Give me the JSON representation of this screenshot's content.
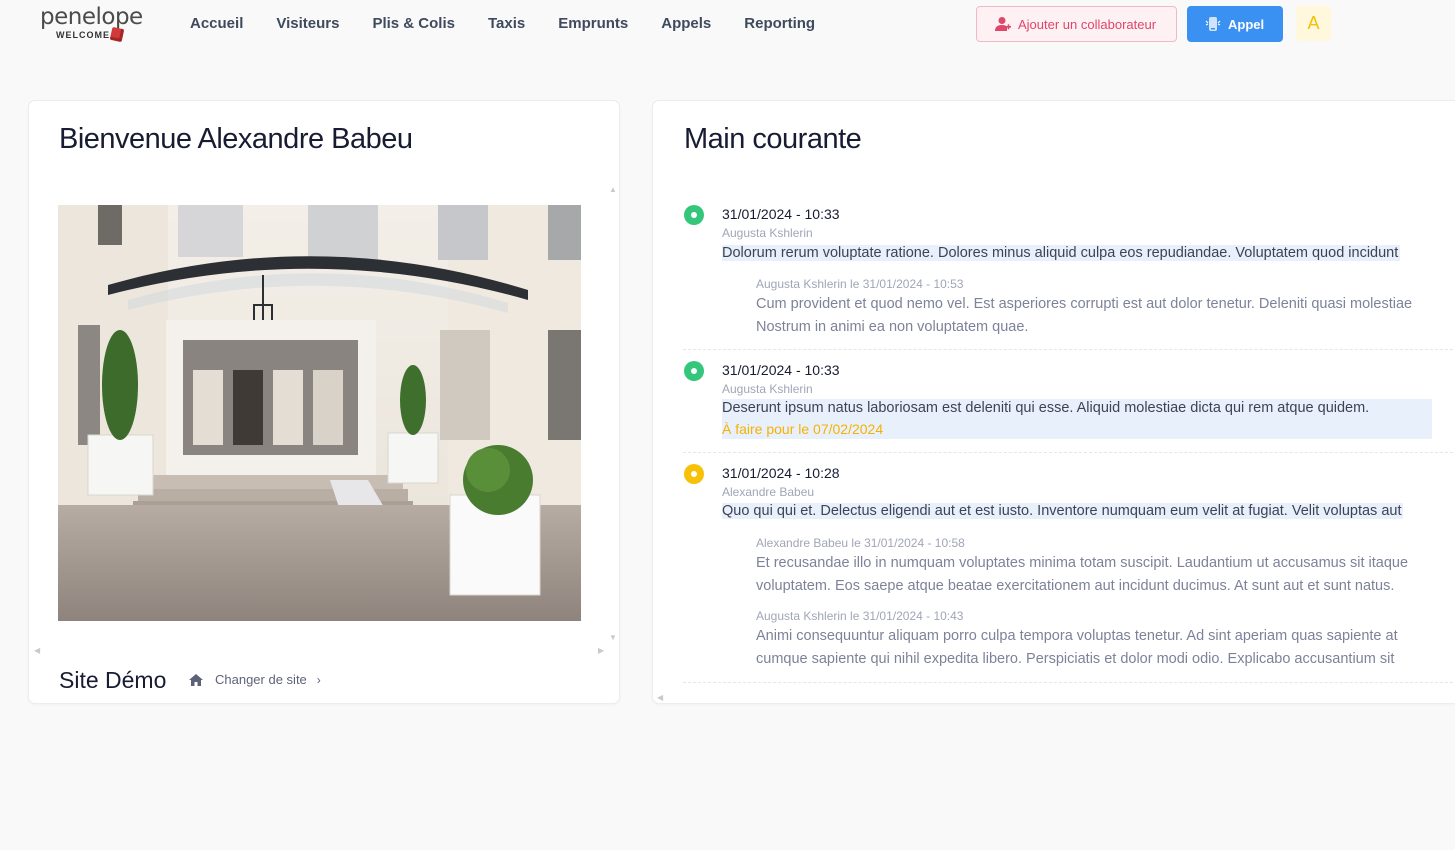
{
  "brand": {
    "name": "penelope",
    "tagline": "WELCOME"
  },
  "nav": [
    "Accueil",
    "Visiteurs",
    "Plis & Colis",
    "Taxis",
    "Emprunts",
    "Appels",
    "Reporting"
  ],
  "header_actions": {
    "add_collaborator": "Ajouter un collaborateur",
    "call": "Appel",
    "avatar_initial": "A"
  },
  "welcome": {
    "title": "Bienvenue Alexandre Babeu",
    "site_name": "Site Démo",
    "change_site": "Changer de site"
  },
  "logbook": {
    "title": "Main courante",
    "entries": [
      {
        "status": "green",
        "datetime": "31/01/2024 - 10:33",
        "author": "Augusta Kshlerin",
        "message": "Dolorum rerum voluptate ratione. Dolores minus aliquid culpa eos repudiandae. Voluptatem quod incidunt",
        "replies": [
          {
            "meta": "Augusta Kshlerin le 31/01/2024 - 10:53",
            "lines": [
              "Cum provident et quod nemo vel. Est asperiores corrupti est aut dolor tenetur. Deleniti quasi molestiae",
              "Nostrum in animi ea non voluptatem quae."
            ]
          }
        ]
      },
      {
        "status": "green",
        "datetime": "31/01/2024 - 10:33",
        "author": "Augusta Kshlerin",
        "message": "Deserunt ipsum natus laboriosam est deleniti qui esse. Aliquid molestiae dicta qui rem atque quidem.",
        "todo": "À faire pour le 07/02/2024",
        "replies": []
      },
      {
        "status": "yellow",
        "datetime": "31/01/2024 - 10:28",
        "author": "Alexandre Babeu",
        "message": "Quo qui qui et. Delectus eligendi aut et est iusto. Inventore numquam eum velit at fugiat. Velit voluptas aut",
        "replies": [
          {
            "meta": "Alexandre Babeu le 31/01/2024 - 10:58",
            "lines": [
              "Et recusandae illo in numquam voluptates minima totam suscipit. Laudantium ut accusamus sit itaque",
              "voluptatem. Eos saepe atque beatae exercitationem aut incidunt ducimus. At sunt aut et sunt natus."
            ]
          },
          {
            "meta": "Augusta Kshlerin le 31/01/2024 - 10:43",
            "lines": [
              "Animi consequuntur aliquam porro culpa tempora voluptas tenetur. Ad sint aperiam quas sapiente at",
              "cumque sapiente qui nihil expedita libero. Perspiciatis et dolor modi odio. Explicabo accusantium sit"
            ]
          }
        ]
      }
    ]
  },
  "colors": {
    "accent": "#3b91f2",
    "danger": "#e0456a",
    "success": "#34c77b",
    "warning": "#f7c10a"
  }
}
